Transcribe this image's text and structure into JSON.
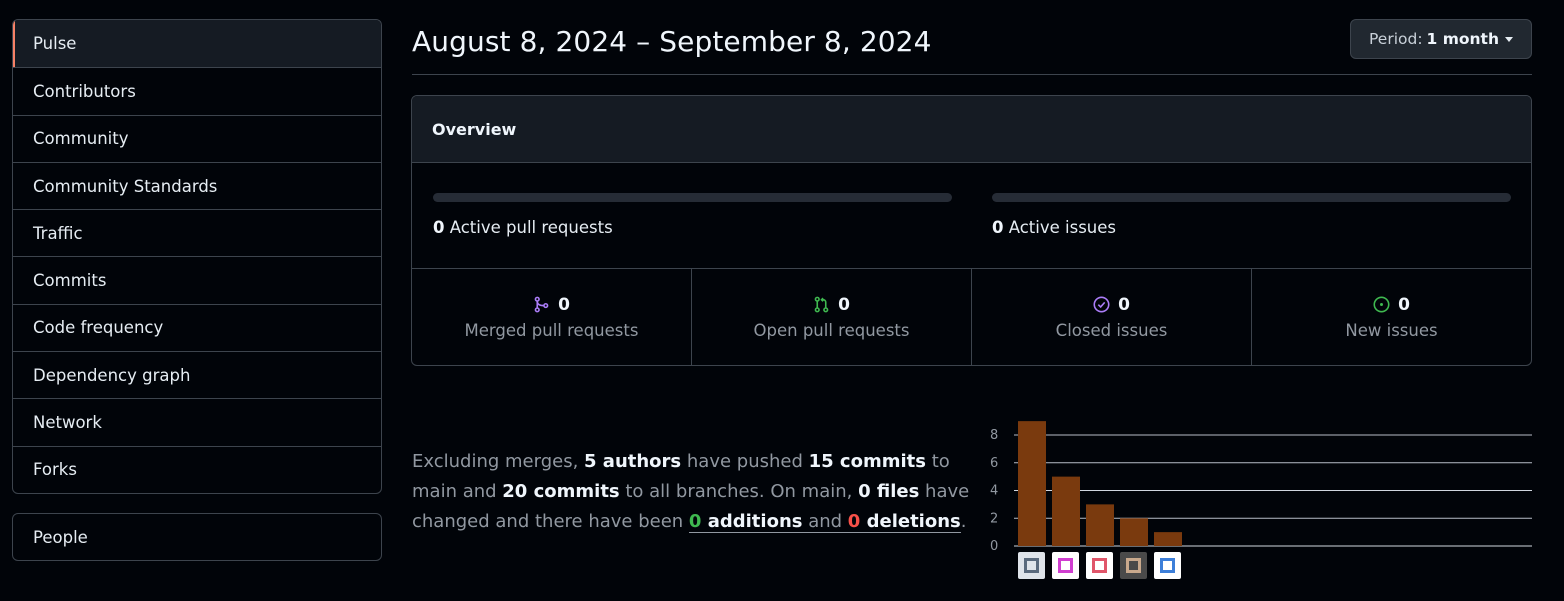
{
  "sidebar": {
    "items": [
      {
        "label": "Pulse",
        "selected": true
      },
      {
        "label": "Contributors"
      },
      {
        "label": "Community"
      },
      {
        "label": "Community Standards"
      },
      {
        "label": "Traffic"
      },
      {
        "label": "Commits"
      },
      {
        "label": "Code frequency"
      },
      {
        "label": "Dependency graph"
      },
      {
        "label": "Network"
      },
      {
        "label": "Forks"
      }
    ],
    "secondary": [
      {
        "label": "People"
      }
    ]
  },
  "header": {
    "date_range": "August 8, 2024 – September 8, 2024",
    "period_prefix": "Period:",
    "period_value": "1 month"
  },
  "overview": {
    "title": "Overview",
    "active_prs_count": "0",
    "active_prs_label": "Active pull requests",
    "active_issues_count": "0",
    "active_issues_label": "Active issues",
    "stats": [
      {
        "count": "0",
        "label": "Merged pull requests",
        "icon": "merge-icon",
        "color": "#ab7df8"
      },
      {
        "count": "0",
        "label": "Open pull requests",
        "icon": "pull-request-icon",
        "color": "#3fb950"
      },
      {
        "count": "0",
        "label": "Closed issues",
        "icon": "issue-closed-icon",
        "color": "#ab7df8"
      },
      {
        "count": "0",
        "label": "New issues",
        "icon": "issue-opened-icon",
        "color": "#3fb950"
      }
    ]
  },
  "summary": {
    "t1": "Excluding merges, ",
    "authors": "5 authors",
    "t2": " have pushed ",
    "commits_main": "15 commits",
    "t3": " to main and ",
    "commits_all": "20 commits",
    "t4": " to all branches. On main, ",
    "files": "0 files",
    "t5": " have changed and there have been ",
    "additions_num": "0",
    "additions_word": " additions",
    "and": " and ",
    "deletions_num": "0",
    "deletions_word": " deletions",
    "end": "."
  },
  "chart_data": {
    "type": "bar",
    "categories": [
      "author-1",
      "author-2",
      "author-3",
      "author-4",
      "author-5"
    ],
    "values": [
      9,
      5,
      3,
      2,
      1
    ],
    "yticks": [
      "8",
      "6",
      "4",
      "2",
      "0"
    ],
    "ylim": [
      0,
      9
    ],
    "bar_color": "#7a3a0e",
    "grid": true
  }
}
